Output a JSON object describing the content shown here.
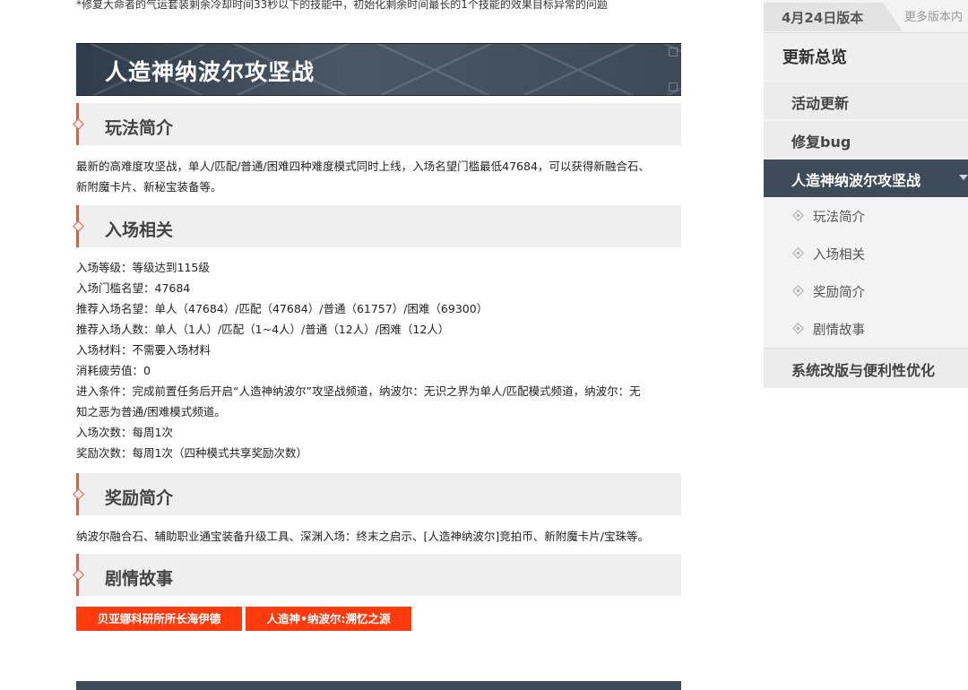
{
  "top_note": "*修复大命者的气运套装剩余冷却时间33秒以下的技能中，初始化剩余时间最长的1个技能的效果目标异常的问题",
  "main_title": "人造神纳波尔攻坚战",
  "sections": {
    "gameplay": {
      "title": "玩法简介",
      "lines": [
        "最新的高难度攻坚战，单人/匹配/普通/困难四种难度模式同时上线，入场名望门槛最低47684，可以获得新融合石、",
        "新附魔卡片、新秘宝装备等。"
      ]
    },
    "entry": {
      "title": "入场相关",
      "lines": [
        "入场等级：等级达到115级",
        "入场门槛名望：47684",
        "推荐入场名望：单人（47684）/匹配（47684）/普通（61757）/困难（69300）",
        "推荐入场人数：单人（1人）/匹配（1~4人）/普通（12人）/困难（12人）",
        "入场材料：不需要入场材料",
        "消耗疲劳值：0",
        "进入条件：完成前置任务后开启“人造神纳波尔”攻坚战频道，纳波尔：无识之界为单人/匹配模式频道，纳波尔：无",
        "知之恶为普通/困难模式频道。",
        "入场次数：每周1次",
        "奖励次数：每周1次（四种模式共享奖励次数）"
      ]
    },
    "rewards": {
      "title": "奖励简介",
      "lines": [
        "纳波尔融合石、辅助职业通宝装备升级工具、深渊入场：终末之启示、[人造神纳波尔]竞拍币、新附魔卡片/宝珠等。"
      ]
    },
    "story": {
      "title": "剧情故事",
      "buttons": [
        "贝亚娜科研所所长海伊德",
        "人造神•纳波尔:溯忆之源"
      ]
    }
  },
  "sidebar": {
    "version_tab": "4月24日版本",
    "more_versions": "更多版本内",
    "overview": "更新总览",
    "items": [
      "活动更新",
      "修复bug"
    ],
    "active_item": "人造神纳波尔攻坚战",
    "sub_items": [
      "玩法简介",
      "入场相关",
      "奖励简介",
      "剧情故事"
    ],
    "last_item": "系统改版与便利性优化"
  },
  "colors": {
    "accent": "#e85a3a",
    "button": "#ff3b0e",
    "header_dark": "#3e4c5a"
  }
}
